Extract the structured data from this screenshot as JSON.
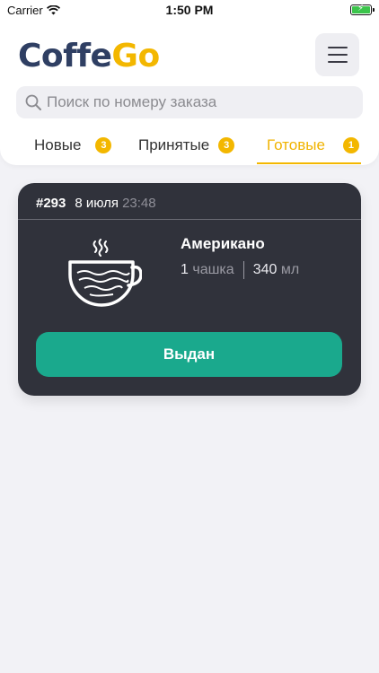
{
  "status_bar": {
    "carrier": "Carrier",
    "time": "1:50 PM"
  },
  "app": {
    "logo_part1": "Coffe",
    "logo_part2": "Go",
    "brand_dark": "#2f3f63",
    "brand_yellow": "#f3b700"
  },
  "search": {
    "placeholder": "Поиск по номеру заказа"
  },
  "tabs": [
    {
      "label": "Новые",
      "count": "3",
      "active": false
    },
    {
      "label": "Принятые",
      "count": "3",
      "active": false
    },
    {
      "label": "Готовые",
      "count": "1",
      "active": true
    }
  ],
  "order": {
    "number": "#293",
    "date": "8 июля",
    "time": "23:48",
    "product": "Американо",
    "cups_num": "1",
    "cups_unit": "чашка",
    "volume_num": "340",
    "volume_unit": "мл",
    "action_label": "Выдан",
    "action_color": "#1aa98d"
  }
}
